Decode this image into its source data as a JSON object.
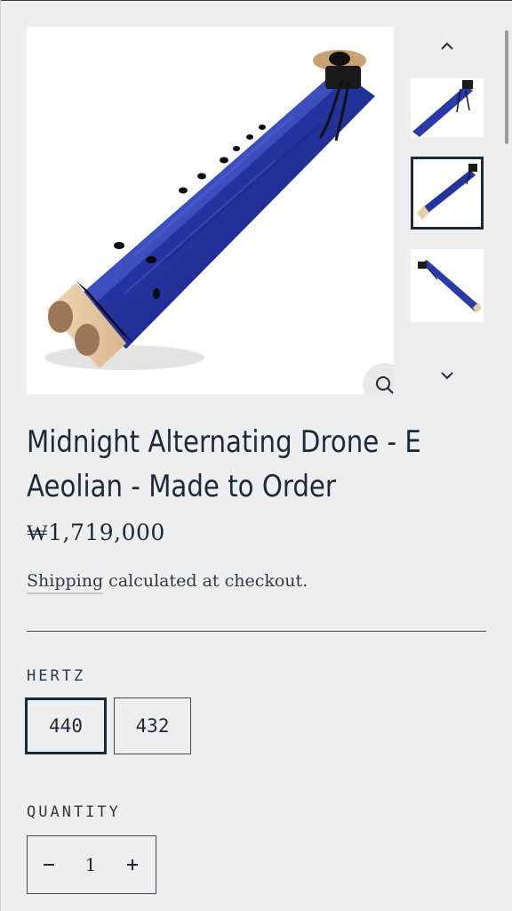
{
  "product": {
    "title": "Midnight Alternating Drone - E Aeolian - Made to Order",
    "price": "₩1,719,000",
    "shipping_link": "Shipping",
    "shipping_rest": " calculated at checkout."
  },
  "gallery": {
    "thumbnail_count": 3,
    "selected_index": 1,
    "icons": [
      "chevron-up-icon",
      "chevron-down-icon",
      "magnifier-icon"
    ]
  },
  "options": {
    "hertz_label": "HERTZ",
    "hertz_values": [
      "440",
      "432"
    ],
    "selected_hertz": "440"
  },
  "quantity": {
    "label": "QUANTITY",
    "value": "1",
    "minus_symbol": "−",
    "plus_symbol": "+"
  },
  "colors": {
    "background": "#eeeeee",
    "text": "#1c2a38",
    "flute_blue": "#2a3aa8"
  }
}
